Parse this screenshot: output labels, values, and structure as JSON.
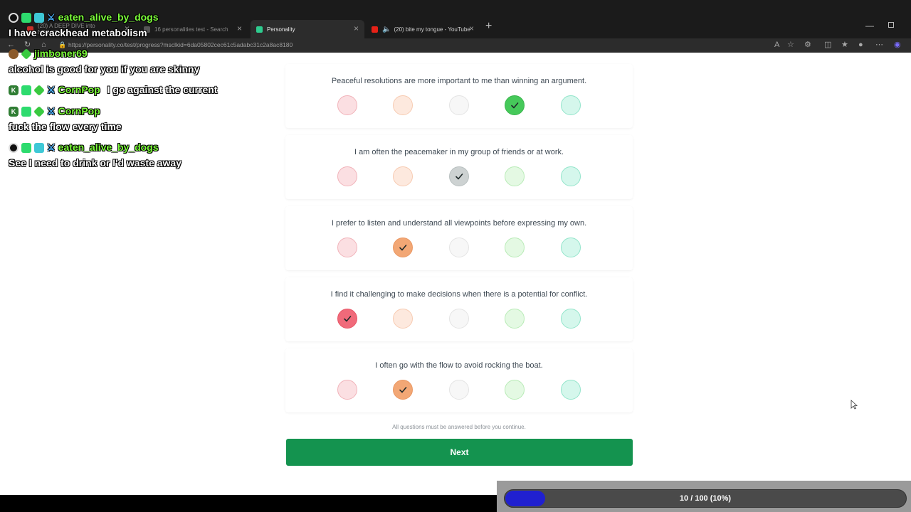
{
  "browser": {
    "tabs": [
      {
        "title": "(20) A DEEP DIVE into NPCs/Golo...",
        "active": false
      },
      {
        "title": "16 personalities test - Search",
        "active": false
      },
      {
        "title": "Personality",
        "active": true
      },
      {
        "title": "(20) bite my tongue - YouTube",
        "active": false
      }
    ],
    "url": "https://personality.co/test/progress?msclkid=6da05802cec61c5adabc31c2a8ac8180"
  },
  "questions": [
    {
      "text": "Peaceful resolutions are more important to me than winning an argument.",
      "selected": 4
    },
    {
      "text": "I am often the peacemaker in my group of friends or at work.",
      "selected": 3
    },
    {
      "text": "I prefer to listen and understand all viewpoints before expressing my own.",
      "selected": 2
    },
    {
      "text": "I find it challenging to make decisions when there is a potential for conflict.",
      "selected": 1
    },
    {
      "text": "I often go with the flow to avoid rocking the boat.",
      "selected": 2
    }
  ],
  "notice": "All questions must be answered before you continue.",
  "next_label": "Next",
  "progress": {
    "label": "10 / 100 (10%)",
    "fraction": 0.1
  },
  "chat": [
    {
      "user": "eaten_alive_by_dogs",
      "message": "I have crackhead metabolism"
    },
    {
      "user": "jimboner69",
      "message": "alcohol is good for you if you are skinny"
    },
    {
      "user": "CornPop",
      "message": "I go against the current"
    },
    {
      "user": "CornPop",
      "message": "fuck the flow every time"
    },
    {
      "user": "eaten_alive_by_dogs",
      "message": "See I need to drink or I'd waste away"
    }
  ],
  "colors": {
    "next_button": "#14934f",
    "progress_fill": "#2020d0",
    "chat_username": "#7cfc3a"
  }
}
